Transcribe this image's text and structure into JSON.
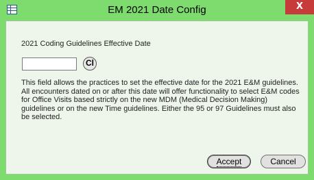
{
  "window": {
    "title": "EM 2021 Date Config",
    "close_glyph": "X"
  },
  "main": {
    "heading": "2021 Coding Guidelines Effective Date",
    "date_value": "",
    "cl_label": "Cl",
    "description": "This field allows the practices to set the effective date for the 2021 E&M guidelines. All encounters dated on or after this date will offer functionality to select E&M codes for Office Visits based strictly on the new MDM (Medical Decision Making) guidelines or on the new Time guidelines. Either the 95 or 97 Guidelines must also be selected."
  },
  "buttons": {
    "accept_label": "Accept",
    "cancel_label": "Cancel"
  },
  "colors": {
    "frame": "#7ddc6d",
    "client_bg": "#eef6ec",
    "close_red": "#c83b3b"
  },
  "icons": {
    "app": "table-icon",
    "close": "close-icon"
  }
}
